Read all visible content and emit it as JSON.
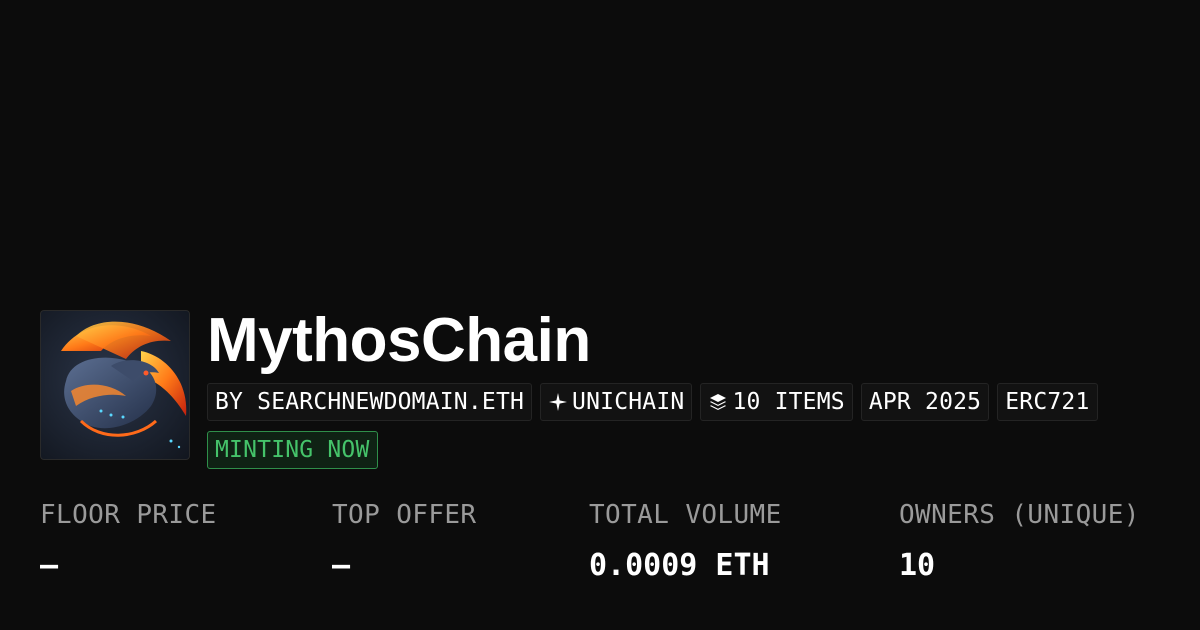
{
  "collection": {
    "name": "MythosChain",
    "avatar_icon": "dragon-artwork-icon"
  },
  "chips": {
    "creator": "BY SEARCHNEWDOMAIN.ETH",
    "chain": "UNICHAIN",
    "chain_icon": "sparkle-icon",
    "items": "10 ITEMS",
    "items_icon": "layers-icon",
    "date": "APR 2025",
    "standard": "ERC721",
    "status": "MINTING NOW"
  },
  "stats": {
    "floor_price": {
      "label": "FLOOR PRICE",
      "value": "–"
    },
    "top_offer": {
      "label": "TOP OFFER",
      "value": "–"
    },
    "total_volume": {
      "label": "TOTAL VOLUME",
      "value": "0.0009 ETH"
    },
    "owners": {
      "label": "OWNERS (UNIQUE)",
      "value": "10"
    }
  },
  "colors": {
    "background": "#0c0c0c",
    "status_green": "#45c36a",
    "muted_label": "#9a9a9a"
  }
}
